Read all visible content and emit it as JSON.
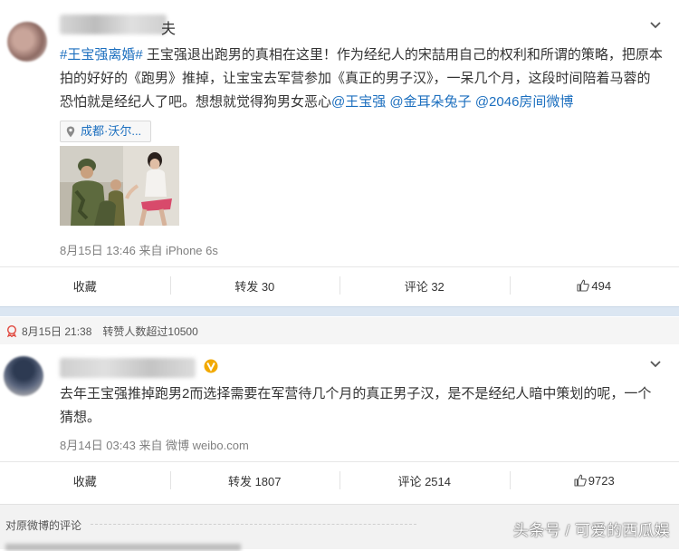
{
  "colors": {
    "link": "#1c6fbf",
    "meta": "#808080",
    "divider": "#dbe6f2",
    "vip_badge": "#f2a900"
  },
  "post1": {
    "name_suffix": "夫",
    "text": {
      "hashtag": "#王宝强离婚#",
      "body1": " 王宝强退出跑男的真相在这里！作为经纪人的宋喆用自己的权利和所谓的策略，把原本拍的好好的《跑男》推掉，让宝宝去军营参加《真正的男子汉》，一呆几个月，这段时间陪着马蓉的恐怕就是经纪人了吧。想想就觉得狗男女恶心",
      "mention1": "@王宝强",
      "mention2": "@金耳朵兔子",
      "mention3": "@2046房间微博"
    },
    "location": "成都·沃尔...",
    "location_icon": "location-pin-icon",
    "meta": "8月15日 13:46 来自 iPhone 6s",
    "actions": {
      "fav": "收藏",
      "repost": "转发 30",
      "comment": "评论 32",
      "like": "494"
    }
  },
  "endorse": {
    "time": "8月15日 21:38",
    "text": "转赞人数超过10500"
  },
  "post2": {
    "text": "去年王宝强推掉跑男2而选择需要在军营待几个月的真正男子汉，是不是经纪人暗中策划的呢，一个猜想。",
    "meta": "8月14日 03:43 来自 微博 weibo.com",
    "actions": {
      "fav": "收藏",
      "repost": "转发 1807",
      "comment": "评论 2514",
      "like": "9723"
    }
  },
  "comments": {
    "label": "对原微博的评论"
  },
  "watermark": "头条号 / 可爱的西瓜娱"
}
